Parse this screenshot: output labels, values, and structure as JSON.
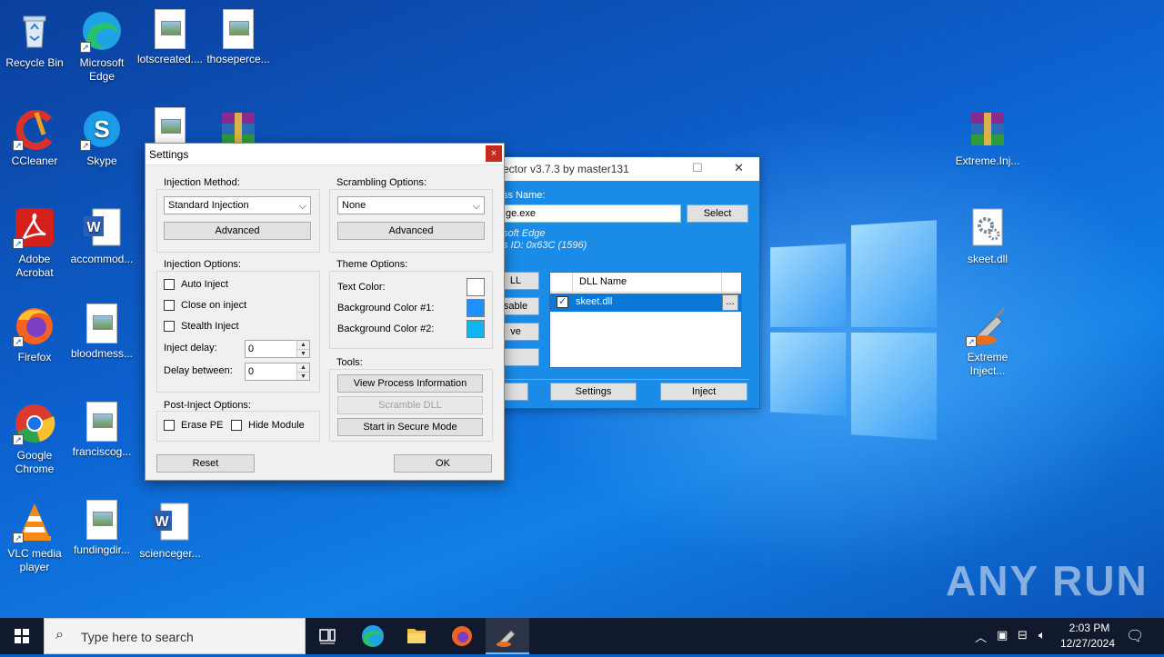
{
  "desktop": {
    "icons": [
      {
        "label": "Recycle Bin",
        "name": "recycle-bin-icon"
      },
      {
        "label": "Microsoft Edge",
        "name": "edge-icon"
      },
      {
        "label": "lotscreated....",
        "name": "image-file-icon"
      },
      {
        "label": "thoseperce...",
        "name": "image-file-icon"
      },
      {
        "label": "CCleaner",
        "name": "ccleaner-icon"
      },
      {
        "label": "Skype",
        "name": "skype-icon"
      },
      {
        "label": "Adobe Acrobat",
        "name": "acrobat-icon"
      },
      {
        "label": "accommod...",
        "name": "word-doc-icon"
      },
      {
        "label": "Firefox",
        "name": "firefox-icon"
      },
      {
        "label": "bloodmess...",
        "name": "image-file-icon"
      },
      {
        "label": "Google Chrome",
        "name": "chrome-icon"
      },
      {
        "label": "franciscog...",
        "name": "image-file-icon"
      },
      {
        "label": "VLC media player",
        "name": "vlc-icon"
      },
      {
        "label": "fundingdir...",
        "name": "image-file-icon"
      },
      {
        "label": "scienceger...",
        "name": "word-doc-icon"
      },
      {
        "label": "Extreme.Inj...",
        "name": "winrar-archive-icon"
      },
      {
        "label": "skeet.dll",
        "name": "dll-file-icon"
      },
      {
        "label": "Extreme Inject...",
        "name": "extreme-injector-icon"
      }
    ],
    "watermark": "ANY RUN"
  },
  "injector": {
    "title": "ector v3.7.3 by master131",
    "process_label": "ss Name:",
    "process_value": "ge.exe",
    "select": "Select",
    "info_line1": "soft Edge",
    "info_line2": "s ID: 0x63C (1596)",
    "side_buttons": [
      "LL",
      "sable",
      "ve",
      ""
    ],
    "dll_header": "DLL Name",
    "dll_row": "skeet.dll",
    "dll_browse": "...",
    "bottom_left": "",
    "settings": "Settings",
    "inject": "Inject"
  },
  "settings": {
    "title": "Settings",
    "close": "×",
    "injection_method": {
      "label": "Injection Method:",
      "selected": "Standard Injection",
      "advanced": "Advanced"
    },
    "scrambling": {
      "label": "Scrambling Options:",
      "selected": "None",
      "advanced": "Advanced"
    },
    "injection_options": {
      "label": "Injection Options:",
      "auto_inject": "Auto Inject",
      "close_on_inject": "Close on inject",
      "stealth_inject": "Stealth Inject",
      "inject_delay_label": "Inject delay:",
      "inject_delay_value": "0",
      "delay_between_label": "Delay between:",
      "delay_between_value": "0"
    },
    "theme": {
      "label": "Theme Options:",
      "text_color_label": "Text Color:",
      "text_color": "#ffffff",
      "bg1_label": "Background Color #1:",
      "bg1_color": "#1e90ff",
      "bg2_label": "Background Color #2:",
      "bg2_color": "#10b4f0"
    },
    "tools": {
      "label": "Tools:",
      "view_process": "View Process Information",
      "scramble_dll": "Scramble DLL",
      "secure_mode": "Start in Secure Mode"
    },
    "post_inject": {
      "label": "Post-Inject Options:",
      "erase_pe": "Erase PE",
      "hide_module": "Hide Module"
    },
    "reset": "Reset",
    "ok": "OK"
  },
  "taskbar": {
    "search_placeholder": "Type here to search",
    "time": "2:03 PM",
    "date": "12/27/2024"
  }
}
